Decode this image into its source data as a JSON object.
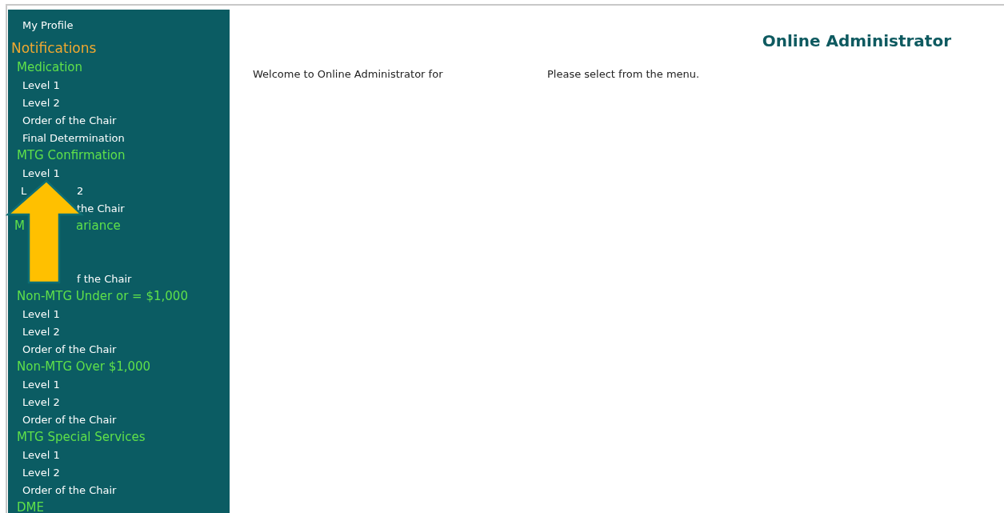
{
  "sidebar": {
    "profile_link": "My Profile",
    "section_title": "Notifications",
    "groups": [
      {
        "kind": "plain",
        "title": "Medication",
        "items": [
          {
            "kind": "link",
            "text": "Level 1"
          },
          {
            "kind": "link",
            "text": "Level 2"
          },
          {
            "kind": "link",
            "text": "Order of the Chair"
          },
          {
            "kind": "link",
            "text": "Final Determination"
          }
        ]
      },
      {
        "kind": "plain",
        "title": "MTG Confirmation",
        "items": [
          {
            "kind": "link",
            "text": "Level 1"
          },
          {
            "kind": "covered",
            "head": "L",
            "tail": "2"
          },
          {
            "kind": "covered",
            "tail": "the Chair"
          }
        ]
      },
      {
        "kind": "covered",
        "head": "M",
        "tail": "ariance",
        "items": [
          {
            "kind": "hidden"
          },
          {
            "kind": "hidden"
          },
          {
            "kind": "covered",
            "tail": "f the Chair"
          }
        ]
      },
      {
        "kind": "plain",
        "title": "Non-MTG Under or = $1,000",
        "items": [
          {
            "kind": "link",
            "text": "Level 1"
          },
          {
            "kind": "link",
            "text": "Level 2"
          },
          {
            "kind": "link",
            "text": "Order of the Chair"
          }
        ]
      },
      {
        "kind": "plain",
        "title": "Non-MTG Over $1,000",
        "items": [
          {
            "kind": "link",
            "text": "Level 1"
          },
          {
            "kind": "link",
            "text": "Level 2"
          },
          {
            "kind": "link",
            "text": "Order of the Chair"
          }
        ]
      },
      {
        "kind": "plain",
        "title": "MTG Special Services",
        "items": [
          {
            "kind": "link",
            "text": "Level 1"
          },
          {
            "kind": "link",
            "text": "Level 2"
          },
          {
            "kind": "link",
            "text": "Order of the Chair"
          }
        ]
      },
      {
        "kind": "plain",
        "title": "DME"
      }
    ]
  },
  "header": {
    "title": "Online Administrator"
  },
  "content": {
    "welcome": "Welcome to Online Administrator for",
    "instruction": "Please select from the menu."
  },
  "overlay": {
    "kind": "arrow"
  }
}
